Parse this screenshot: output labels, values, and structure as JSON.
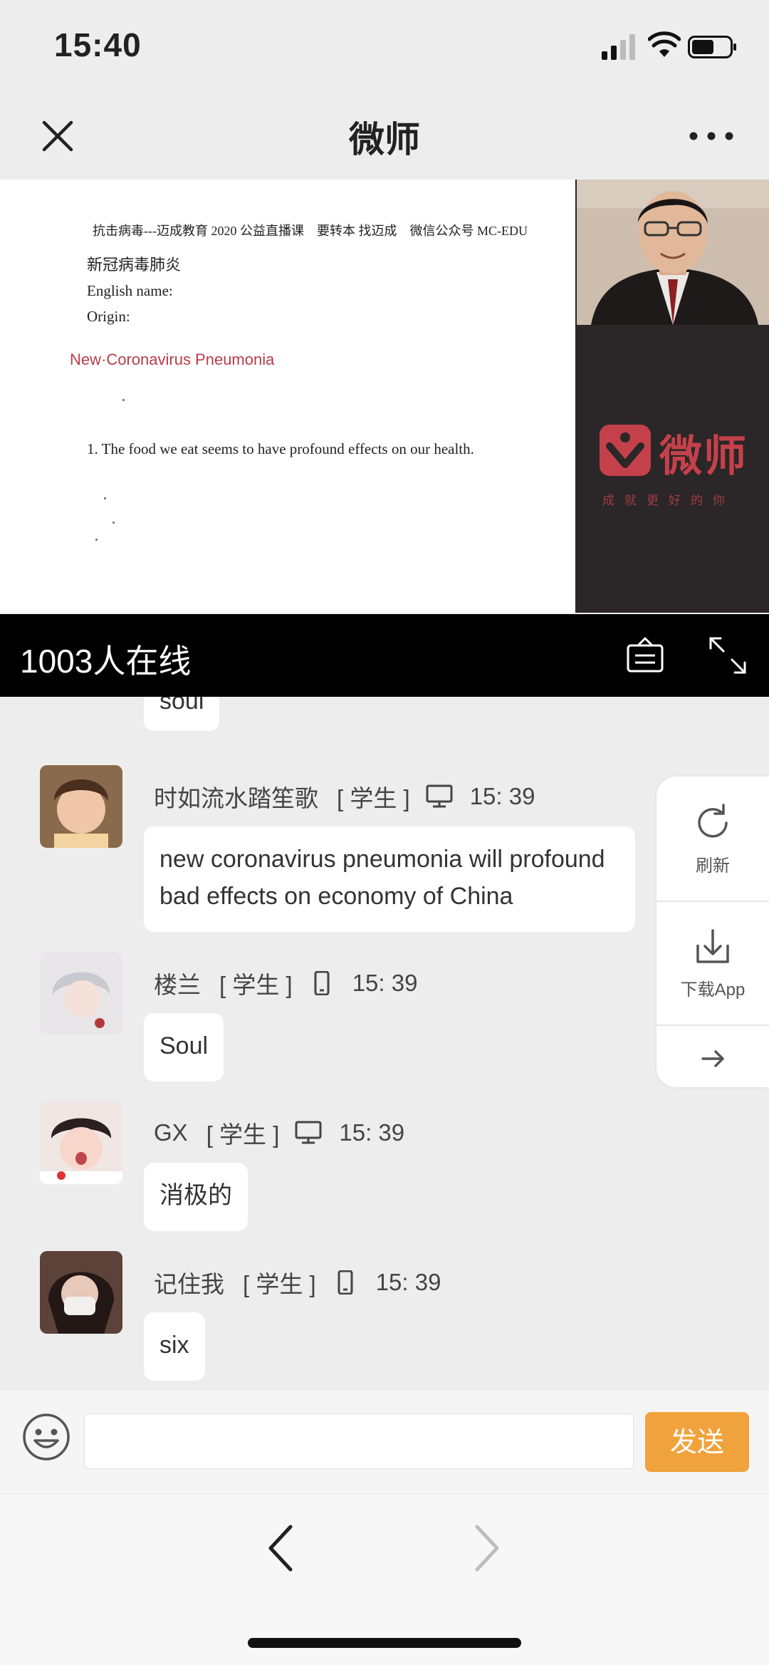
{
  "status_bar": {
    "time": "15:40"
  },
  "nav": {
    "title": "微师"
  },
  "slide": {
    "header": "抗击病毒---迈成教育 2020 公益直播课　要转本 找迈成　微信公众号 MC-EDU",
    "line1": "新冠病毒肺炎",
    "line2": "English name:",
    "line3": "Origin:",
    "highlight": "New·Coronavirus Pneumonia",
    "item1": "1. The food we eat seems to have profound effects on our health."
  },
  "brand": {
    "name": "微师",
    "tagline": "成就更好的你"
  },
  "online": {
    "count_text": "1003人在线"
  },
  "chat": {
    "partial_message": "soul",
    "messages": [
      {
        "name": "时如流水踏笙歌",
        "role": "[ 学生 ]",
        "device": "desktop-icon",
        "time": "15: 39",
        "text": "new coronavirus pneumonia will profound bad effects on economy of China"
      },
      {
        "name": "楼兰",
        "role": "[ 学生 ]",
        "device": "phone-icon",
        "time": "15: 39",
        "text": "Soul"
      },
      {
        "name": "GX",
        "role": "[ 学生 ]",
        "device": "desktop-icon",
        "time": "15: 39",
        "text": "消极的"
      },
      {
        "name": "记住我",
        "role": "[ 学生 ]",
        "device": "phone-icon",
        "time": "15: 39",
        "text": "six"
      }
    ]
  },
  "side_panel": {
    "refresh_label": "刷新",
    "download_label": "下载App"
  },
  "input": {
    "placeholder": "",
    "send_label": "发送"
  },
  "colors": {
    "accent": "#f0a33c",
    "brand_red": "#c4414b",
    "chat_bg": "#ededed"
  }
}
